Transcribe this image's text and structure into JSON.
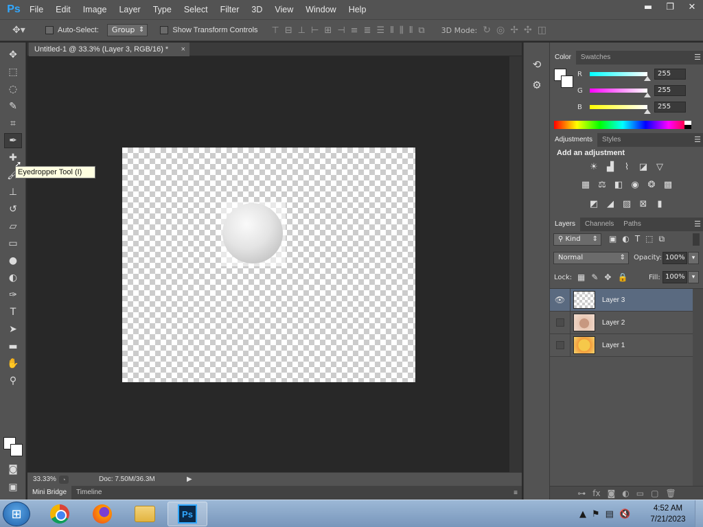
{
  "app": {
    "logo": "Ps"
  },
  "menu": [
    "File",
    "Edit",
    "Image",
    "Layer",
    "Type",
    "Select",
    "Filter",
    "3D",
    "View",
    "Window",
    "Help"
  ],
  "window_controls": {
    "minimize": "▬",
    "restore": "❐",
    "close": "✕"
  },
  "options": {
    "auto_select": "Auto-Select:",
    "group": "Group",
    "show_transform": "Show Transform Controls",
    "mode_3d": "3D Mode:"
  },
  "document": {
    "tab_title": "Untitled-1 @ 33.3% (Layer 3, RGB/16) *",
    "close": "×"
  },
  "tooltip": "Eyedropper Tool (I)",
  "status": {
    "zoom": "33.33%",
    "doc": "Doc: 7.50M/36.3M"
  },
  "bottom_tabs": [
    "Mini Bridge",
    "Timeline"
  ],
  "color_panel": {
    "tabs": [
      "Color",
      "Swatches"
    ],
    "sliders": [
      {
        "label": "R",
        "value": "255"
      },
      {
        "label": "G",
        "value": "255"
      },
      {
        "label": "B",
        "value": "255"
      }
    ]
  },
  "adjustments_panel": {
    "tabs": [
      "Adjustments",
      "Styles"
    ],
    "heading": "Add an adjustment"
  },
  "layers_panel": {
    "tabs": [
      "Layers",
      "Channels",
      "Paths"
    ],
    "kind": "Kind",
    "blend_mode": "Normal",
    "opacity_label": "Opacity:",
    "opacity": "100%",
    "lock_label": "Lock:",
    "fill_label": "Fill:",
    "fill": "100%",
    "layers": [
      "Layer 3",
      "Layer 2",
      "Layer 1"
    ]
  },
  "taskbar": {
    "time": "4:52 AM",
    "date": "7/21/2023"
  },
  "colors": {
    "accent": "#31a8ff",
    "selected_layer": "#5a6a80"
  }
}
